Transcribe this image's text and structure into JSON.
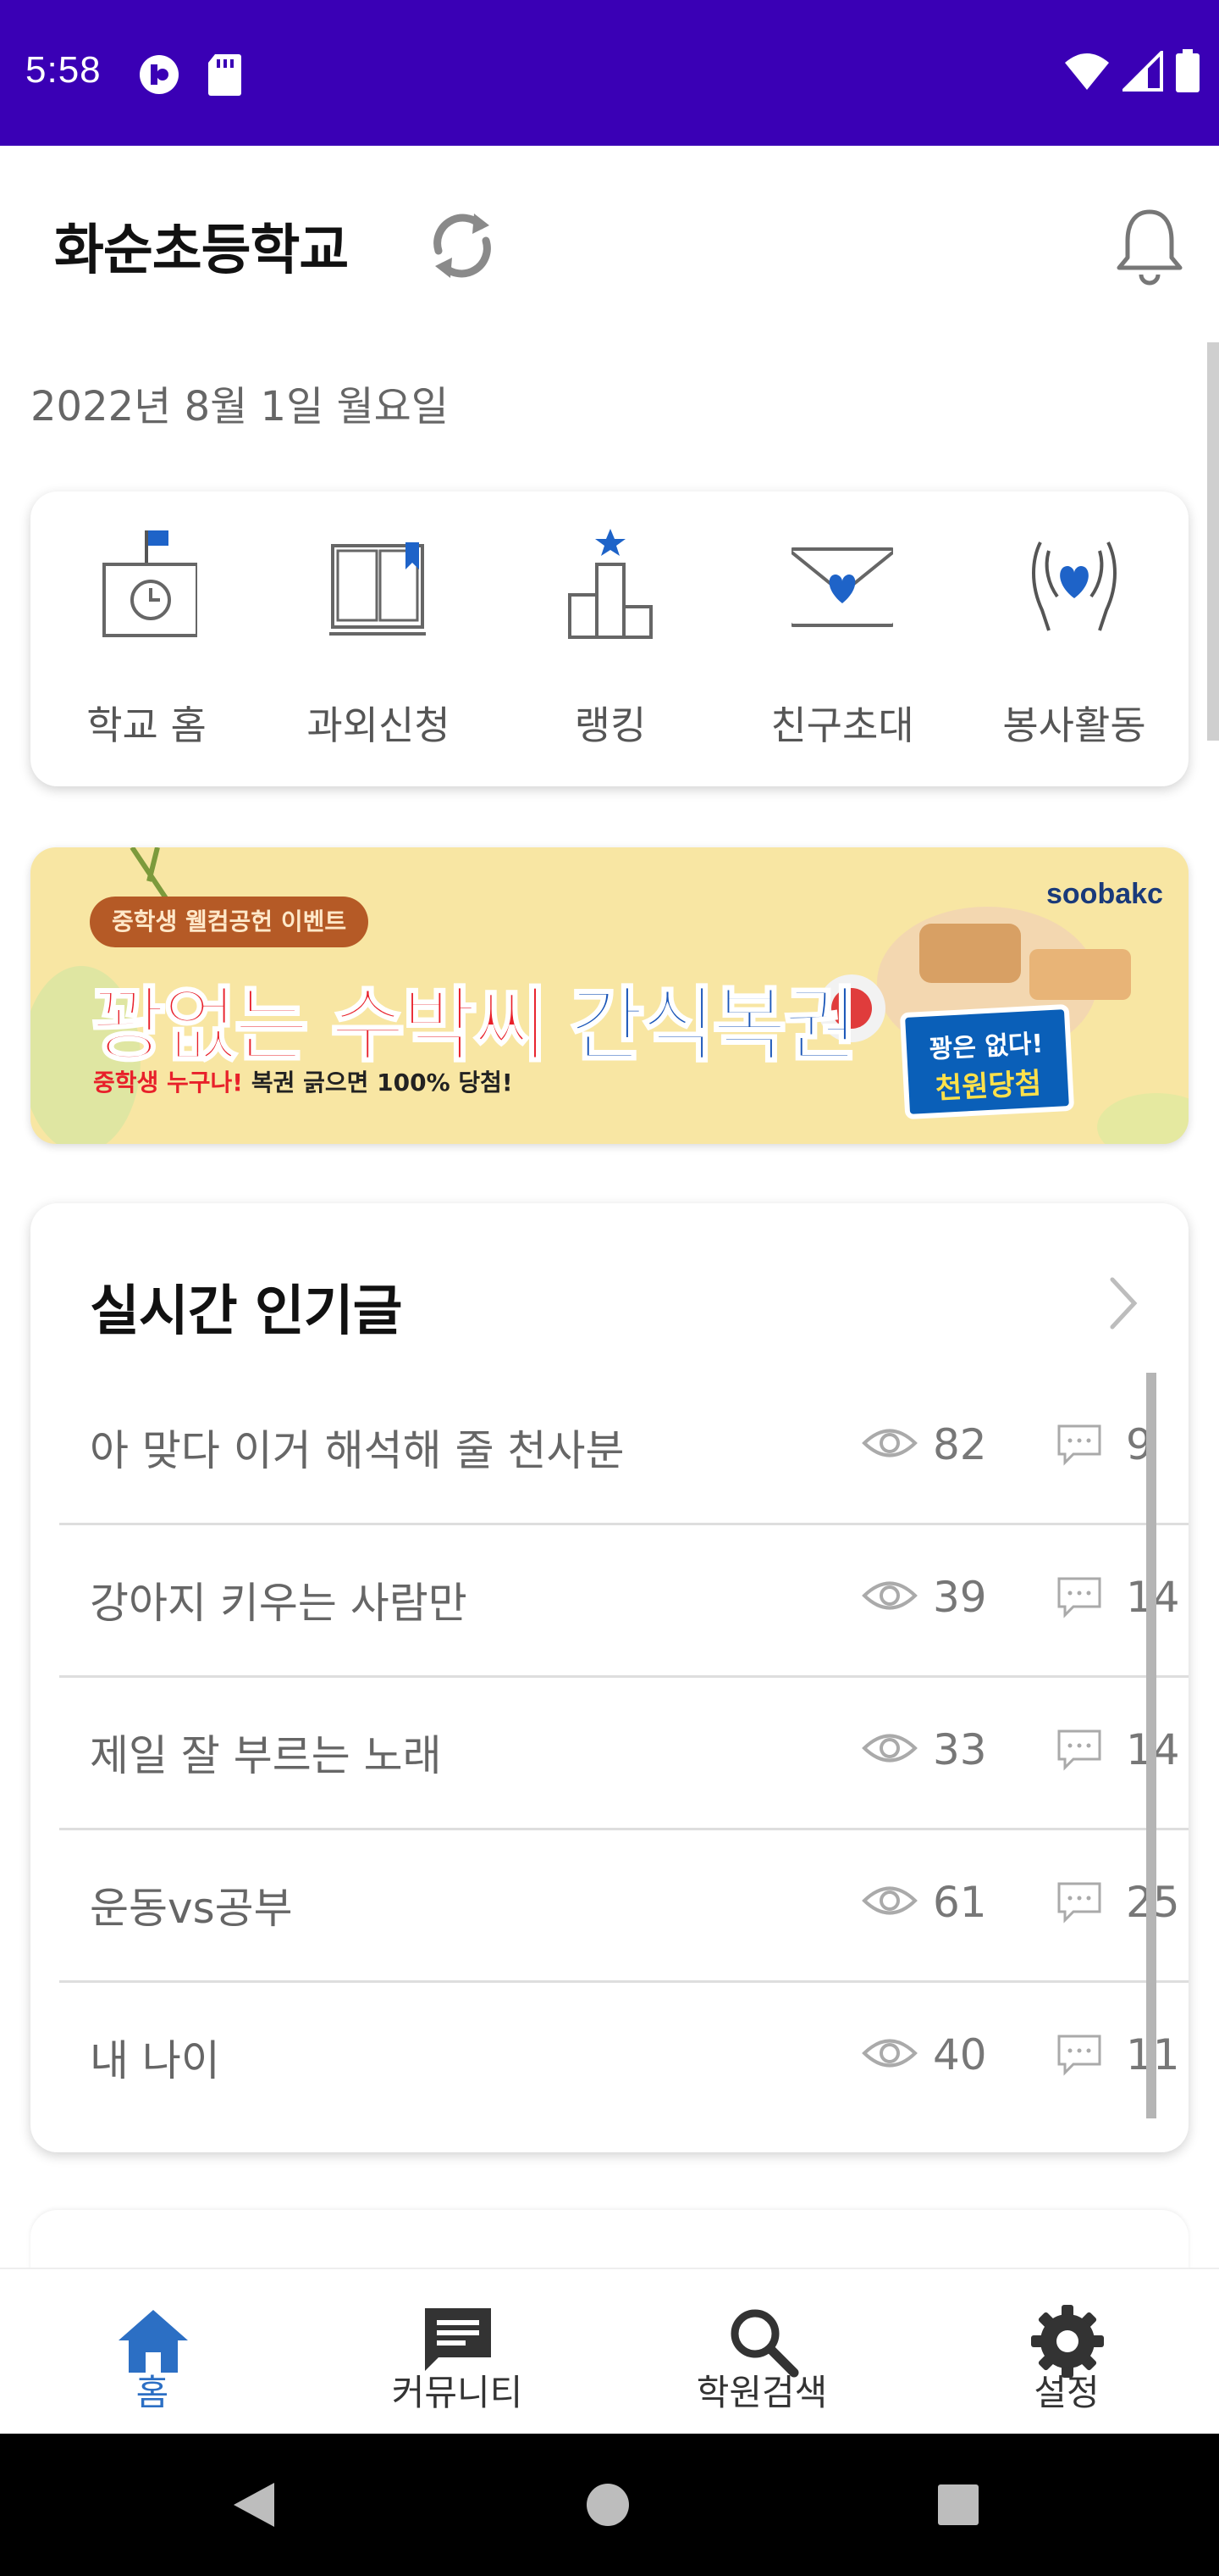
{
  "status_bar": {
    "time": "5:58"
  },
  "header": {
    "school_name": "화순초등학교"
  },
  "date": "2022년 8월 1일 월요일",
  "menu": [
    {
      "label": "학교 홈",
      "icon": "school-clock-icon"
    },
    {
      "label": "과외신청",
      "icon": "book-icon"
    },
    {
      "label": "랭킹",
      "icon": "ranking-podium-icon"
    },
    {
      "label": "친구초대",
      "icon": "invite-envelope-icon"
    },
    {
      "label": "봉사활동",
      "icon": "volunteer-hands-icon"
    }
  ],
  "banner": {
    "pill": "중학생 웰컴공헌 이벤트",
    "headline_red": "꽝없는 수박씨",
    "headline_blue": "간식복권",
    "sub_highlight": "중학생 누구나!",
    "sub_rest": " 복권 긁으면 100% 당첨!",
    "brand": "soobakc",
    "ticket_line1": "꽝은 없다!",
    "ticket_line2": "천원당첨"
  },
  "popular": {
    "title": "실시간 인기글",
    "posts": [
      {
        "title": "아 맞다 이거 해석해 줄 천사분",
        "views": "82",
        "comments": "9"
      },
      {
        "title": "강아지 키우는 사람만",
        "views": "39",
        "comments": "14"
      },
      {
        "title": "제일 잘 부르는 노래",
        "views": "33",
        "comments": "14"
      },
      {
        "title": "운동vs공부",
        "views": "61",
        "comments": "25"
      },
      {
        "title": "내 나이",
        "views": "40",
        "comments": "11"
      }
    ]
  },
  "bottom_nav": [
    {
      "label": "홈",
      "icon": "home-icon",
      "active": true
    },
    {
      "label": "커뮤니티",
      "icon": "chat-icon",
      "active": false
    },
    {
      "label": "학원검색",
      "icon": "search-icon",
      "active": false
    },
    {
      "label": "설정",
      "icon": "gear-icon",
      "active": false
    }
  ],
  "colors": {
    "status_bar": "#3a00b5",
    "accent": "#2c6fc4",
    "icon_blue": "#1e63c8"
  }
}
